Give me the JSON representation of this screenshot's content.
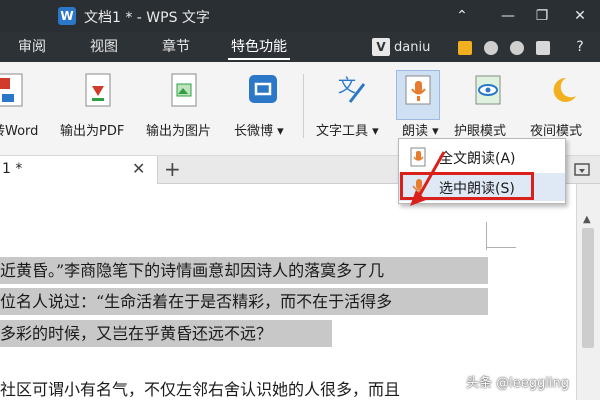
{
  "window": {
    "app_logo_letter": "W",
    "title": "文档1 * - WPS 文字",
    "controls": [
      "⌃",
      "—",
      "❐",
      "✕"
    ]
  },
  "menubar": {
    "tabs": [
      {
        "label": "审阅",
        "active": false
      },
      {
        "label": "视图",
        "active": false
      },
      {
        "label": "章节",
        "active": false
      },
      {
        "label": "特色功能",
        "active": true
      }
    ],
    "user_letter": "V",
    "username": "daniu",
    "right_icons": [
      "mail-icon",
      "shield-icon",
      "skin-icon",
      "shirt-icon",
      "help-icon"
    ],
    "help_label": "?"
  },
  "ribbon": {
    "items": [
      {
        "label": "转Word",
        "icon": "word-convert-icon"
      },
      {
        "label": "输出为PDF",
        "icon": "pdf-export-icon"
      },
      {
        "label": "输出为图片",
        "icon": "image-export-icon"
      },
      {
        "label": "长微博",
        "icon": "weibo-icon",
        "has_arrow": true
      },
      {
        "label": "文字工具",
        "icon": "text-tools-icon",
        "has_arrow": true
      },
      {
        "label": "朗读",
        "icon": "read-aloud-icon",
        "has_arrow": true,
        "active": true
      },
      {
        "label": "护眼模式",
        "icon": "eye-protect-icon"
      },
      {
        "label": "夜间模式",
        "icon": "night-mode-icon"
      }
    ]
  },
  "doc_tabs": {
    "active_label": "1 *",
    "close": "✕",
    "new": "+"
  },
  "dropdown": {
    "items": [
      {
        "label": "全文朗读(A)"
      },
      {
        "label": "选中朗读(S)",
        "highlighted": true
      }
    ]
  },
  "document": {
    "lines": [
      {
        "text": "近黄昏。”李商隐笔下的诗情画意却因诗人的落寞多了几",
        "selected": true
      },
      {
        "text": "位名人说过：“生命活着在于是否精彩，而不在于活得多",
        "selected": true
      },
      {
        "text": "多彩的时候，又岂在乎黄昏还远不远？",
        "selected": true
      },
      {
        "text": "社区可谓小有名气，不仅左邻右舍认识她的人很多，而且",
        "selected": false
      }
    ]
  },
  "watermark": "头条 @leeggling",
  "colors": {
    "titlebar": "#2a2f33",
    "selection": "#c8c8c8",
    "annotation_red": "#d9201b",
    "accent_blue": "#2b78c9"
  }
}
